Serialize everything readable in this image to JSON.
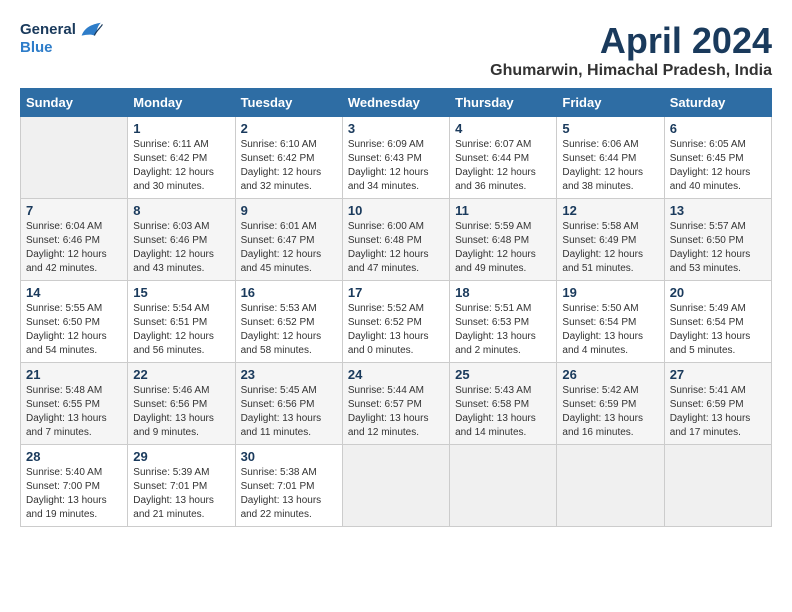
{
  "header": {
    "logo_general": "General",
    "logo_blue": "Blue",
    "month_title": "April 2024",
    "location": "Ghumarwin, Himachal Pradesh, India"
  },
  "weekdays": [
    "Sunday",
    "Monday",
    "Tuesday",
    "Wednesday",
    "Thursday",
    "Friday",
    "Saturday"
  ],
  "weeks": [
    [
      {
        "day": "",
        "sunrise": "",
        "sunset": "",
        "daylight": ""
      },
      {
        "day": "1",
        "sunrise": "Sunrise: 6:11 AM",
        "sunset": "Sunset: 6:42 PM",
        "daylight": "Daylight: 12 hours and 30 minutes."
      },
      {
        "day": "2",
        "sunrise": "Sunrise: 6:10 AM",
        "sunset": "Sunset: 6:42 PM",
        "daylight": "Daylight: 12 hours and 32 minutes."
      },
      {
        "day": "3",
        "sunrise": "Sunrise: 6:09 AM",
        "sunset": "Sunset: 6:43 PM",
        "daylight": "Daylight: 12 hours and 34 minutes."
      },
      {
        "day": "4",
        "sunrise": "Sunrise: 6:07 AM",
        "sunset": "Sunset: 6:44 PM",
        "daylight": "Daylight: 12 hours and 36 minutes."
      },
      {
        "day": "5",
        "sunrise": "Sunrise: 6:06 AM",
        "sunset": "Sunset: 6:44 PM",
        "daylight": "Daylight: 12 hours and 38 minutes."
      },
      {
        "day": "6",
        "sunrise": "Sunrise: 6:05 AM",
        "sunset": "Sunset: 6:45 PM",
        "daylight": "Daylight: 12 hours and 40 minutes."
      }
    ],
    [
      {
        "day": "7",
        "sunrise": "Sunrise: 6:04 AM",
        "sunset": "Sunset: 6:46 PM",
        "daylight": "Daylight: 12 hours and 42 minutes."
      },
      {
        "day": "8",
        "sunrise": "Sunrise: 6:03 AM",
        "sunset": "Sunset: 6:46 PM",
        "daylight": "Daylight: 12 hours and 43 minutes."
      },
      {
        "day": "9",
        "sunrise": "Sunrise: 6:01 AM",
        "sunset": "Sunset: 6:47 PM",
        "daylight": "Daylight: 12 hours and 45 minutes."
      },
      {
        "day": "10",
        "sunrise": "Sunrise: 6:00 AM",
        "sunset": "Sunset: 6:48 PM",
        "daylight": "Daylight: 12 hours and 47 minutes."
      },
      {
        "day": "11",
        "sunrise": "Sunrise: 5:59 AM",
        "sunset": "Sunset: 6:48 PM",
        "daylight": "Daylight: 12 hours and 49 minutes."
      },
      {
        "day": "12",
        "sunrise": "Sunrise: 5:58 AM",
        "sunset": "Sunset: 6:49 PM",
        "daylight": "Daylight: 12 hours and 51 minutes."
      },
      {
        "day": "13",
        "sunrise": "Sunrise: 5:57 AM",
        "sunset": "Sunset: 6:50 PM",
        "daylight": "Daylight: 12 hours and 53 minutes."
      }
    ],
    [
      {
        "day": "14",
        "sunrise": "Sunrise: 5:55 AM",
        "sunset": "Sunset: 6:50 PM",
        "daylight": "Daylight: 12 hours and 54 minutes."
      },
      {
        "day": "15",
        "sunrise": "Sunrise: 5:54 AM",
        "sunset": "Sunset: 6:51 PM",
        "daylight": "Daylight: 12 hours and 56 minutes."
      },
      {
        "day": "16",
        "sunrise": "Sunrise: 5:53 AM",
        "sunset": "Sunset: 6:52 PM",
        "daylight": "Daylight: 12 hours and 58 minutes."
      },
      {
        "day": "17",
        "sunrise": "Sunrise: 5:52 AM",
        "sunset": "Sunset: 6:52 PM",
        "daylight": "Daylight: 13 hours and 0 minutes."
      },
      {
        "day": "18",
        "sunrise": "Sunrise: 5:51 AM",
        "sunset": "Sunset: 6:53 PM",
        "daylight": "Daylight: 13 hours and 2 minutes."
      },
      {
        "day": "19",
        "sunrise": "Sunrise: 5:50 AM",
        "sunset": "Sunset: 6:54 PM",
        "daylight": "Daylight: 13 hours and 4 minutes."
      },
      {
        "day": "20",
        "sunrise": "Sunrise: 5:49 AM",
        "sunset": "Sunset: 6:54 PM",
        "daylight": "Daylight: 13 hours and 5 minutes."
      }
    ],
    [
      {
        "day": "21",
        "sunrise": "Sunrise: 5:48 AM",
        "sunset": "Sunset: 6:55 PM",
        "daylight": "Daylight: 13 hours and 7 minutes."
      },
      {
        "day": "22",
        "sunrise": "Sunrise: 5:46 AM",
        "sunset": "Sunset: 6:56 PM",
        "daylight": "Daylight: 13 hours and 9 minutes."
      },
      {
        "day": "23",
        "sunrise": "Sunrise: 5:45 AM",
        "sunset": "Sunset: 6:56 PM",
        "daylight": "Daylight: 13 hours and 11 minutes."
      },
      {
        "day": "24",
        "sunrise": "Sunrise: 5:44 AM",
        "sunset": "Sunset: 6:57 PM",
        "daylight": "Daylight: 13 hours and 12 minutes."
      },
      {
        "day": "25",
        "sunrise": "Sunrise: 5:43 AM",
        "sunset": "Sunset: 6:58 PM",
        "daylight": "Daylight: 13 hours and 14 minutes."
      },
      {
        "day": "26",
        "sunrise": "Sunrise: 5:42 AM",
        "sunset": "Sunset: 6:59 PM",
        "daylight": "Daylight: 13 hours and 16 minutes."
      },
      {
        "day": "27",
        "sunrise": "Sunrise: 5:41 AM",
        "sunset": "Sunset: 6:59 PM",
        "daylight": "Daylight: 13 hours and 17 minutes."
      }
    ],
    [
      {
        "day": "28",
        "sunrise": "Sunrise: 5:40 AM",
        "sunset": "Sunset: 7:00 PM",
        "daylight": "Daylight: 13 hours and 19 minutes."
      },
      {
        "day": "29",
        "sunrise": "Sunrise: 5:39 AM",
        "sunset": "Sunset: 7:01 PM",
        "daylight": "Daylight: 13 hours and 21 minutes."
      },
      {
        "day": "30",
        "sunrise": "Sunrise: 5:38 AM",
        "sunset": "Sunset: 7:01 PM",
        "daylight": "Daylight: 13 hours and 22 minutes."
      },
      {
        "day": "",
        "sunrise": "",
        "sunset": "",
        "daylight": ""
      },
      {
        "day": "",
        "sunrise": "",
        "sunset": "",
        "daylight": ""
      },
      {
        "day": "",
        "sunrise": "",
        "sunset": "",
        "daylight": ""
      },
      {
        "day": "",
        "sunrise": "",
        "sunset": "",
        "daylight": ""
      }
    ]
  ]
}
